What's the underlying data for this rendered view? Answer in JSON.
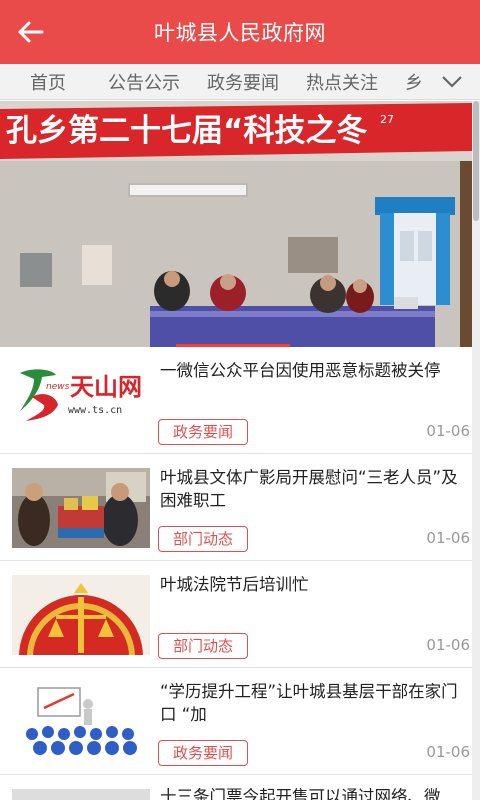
{
  "colors": {
    "header": "#e94a4a",
    "tag": "#e05050",
    "banner_indicator": "#ff3b30"
  },
  "header": {
    "title": "叶城县人民政府网",
    "back_icon": "arrow-left-icon"
  },
  "tabs": {
    "items": [
      "首页",
      "公告公示",
      "政务要闻",
      "热点关注",
      "乡"
    ],
    "more_icon": "chevron-down-icon"
  },
  "banner": {
    "sign_text": "孔乡第二十七届“科技之冬",
    "sign_number": "27"
  },
  "news": [
    {
      "title": "一微信公众平台因使用恶意标题被关停",
      "tag": "政务要闻",
      "date": "01-06",
      "thumb": {
        "brand": "天山网",
        "url": "www.ts.cn",
        "news": "news"
      }
    },
    {
      "title": "叶城县文体广影局开展慰问“三老人员”及困难职工",
      "tag": "部门动态",
      "date": "01-06"
    },
    {
      "title": "叶城法院节后培训忙",
      "tag": "部门动态",
      "date": "01-06"
    },
    {
      "title": "“学历提升工程”让叶城县基层干部在家门口 “加",
      "tag": "政务要闻",
      "date": "01-06"
    },
    {
      "title": "十三条门票今起开售可以通过网络、微"
    }
  ]
}
